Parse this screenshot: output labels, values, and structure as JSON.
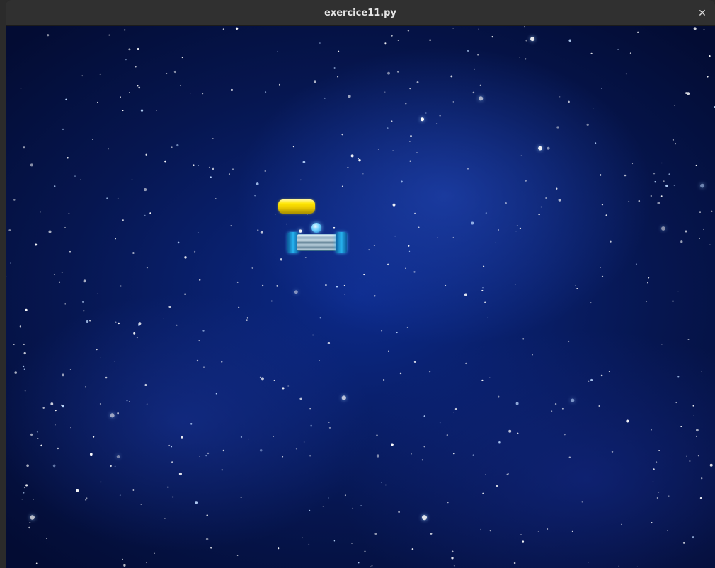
{
  "window": {
    "title": "exercice11.py",
    "minimize_glyph": "–",
    "close_glyph": "✕"
  },
  "game": {
    "background": "starfield-space",
    "objects": [
      "yellow-brick",
      "ball",
      "paddle"
    ],
    "colors": {
      "brick": "#ffe600",
      "ball": "#6fd0ff",
      "paddle_accent": "#27b4f0",
      "space": "#0c2a8a"
    }
  }
}
